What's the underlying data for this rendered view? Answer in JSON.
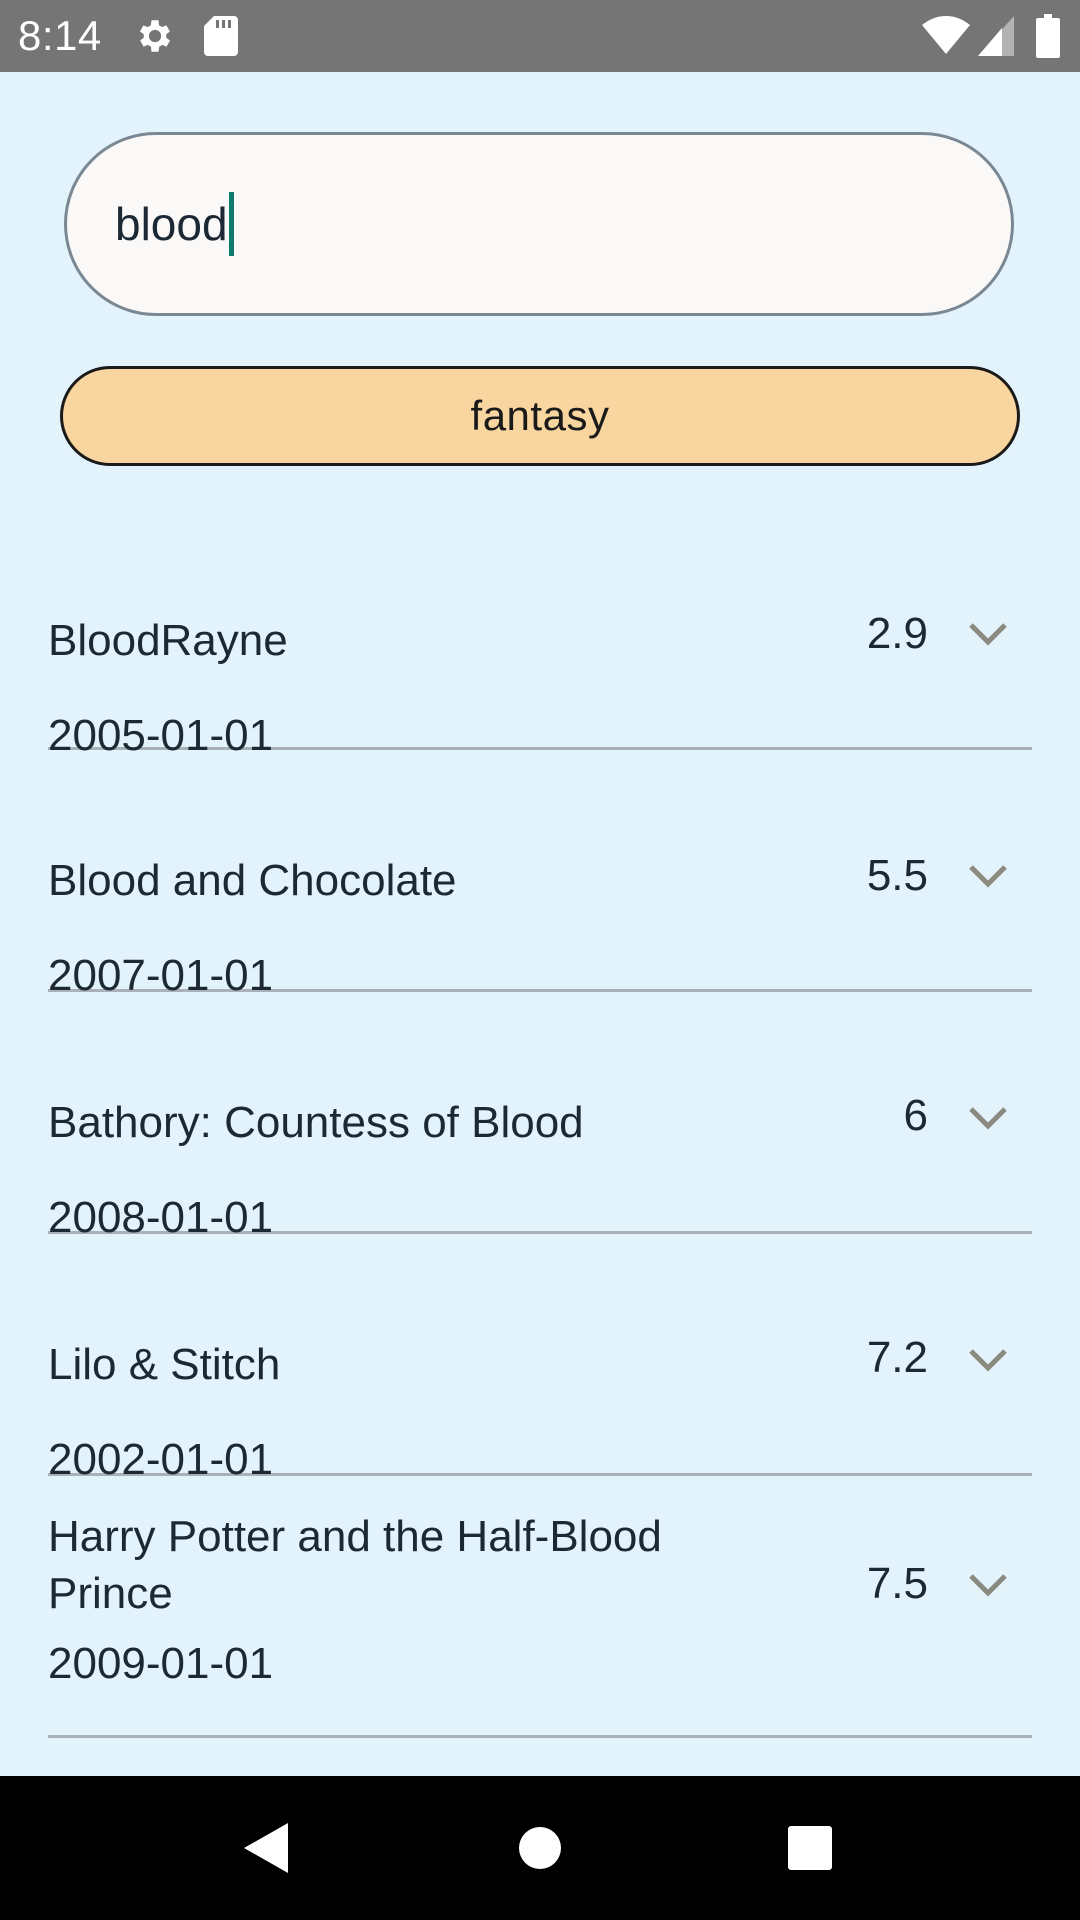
{
  "status_bar": {
    "time": "8:14",
    "icons": [
      "gear-icon",
      "sd-card-icon",
      "wifi-icon",
      "cell-signal-icon",
      "battery-icon"
    ]
  },
  "search": {
    "value": "blood"
  },
  "genre_button": {
    "label": "fantasy",
    "color": "#f9d69f"
  },
  "results": [
    {
      "title": "BloodRayne",
      "date": "2005-01-01",
      "rating": "2.9"
    },
    {
      "title": "Blood and Chocolate",
      "date": "2007-01-01",
      "rating": "5.5"
    },
    {
      "title": "Bathory: Countess of Blood",
      "date": "2008-01-01",
      "rating": "6"
    },
    {
      "title": "Lilo & Stitch",
      "date": "2002-01-01",
      "rating": "7.2"
    },
    {
      "title": "Harry Potter and the Half-Blood Prince",
      "date": "2009-01-01",
      "rating": "7.5"
    }
  ],
  "nav_bar": {
    "icons": [
      "back-icon",
      "home-icon",
      "recents-icon"
    ]
  },
  "colors": {
    "background": "#e3f3fc",
    "status_bar": "#757575",
    "caret": "#0f7b6c",
    "chevron": "#8a8a80"
  }
}
